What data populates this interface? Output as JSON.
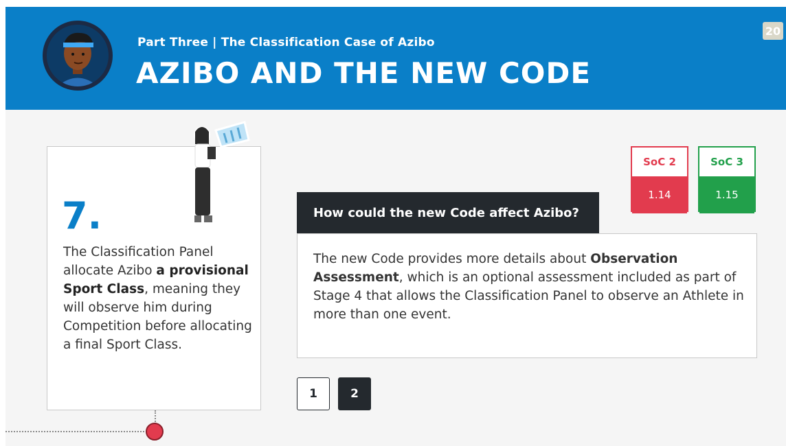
{
  "header": {
    "subtitle": "Part Three | The Classification Case of Azibo",
    "title": "AZIBO AND THE NEW CODE",
    "page_number": "20"
  },
  "left_card": {
    "step": "7.",
    "text_1": "The Classification Panel allocate Azibo ",
    "text_bold": "a provisional Sport Class",
    "text_2": ", meaning they will observe him during Competition before allocating a final Sport Class."
  },
  "soc": [
    {
      "label": "SoC 2",
      "value": "1.14",
      "color": "#e23b4e"
    },
    {
      "label": "SoC 3",
      "value": "1.15",
      "color": "#22a04b"
    }
  ],
  "question": {
    "title": "How could the new Code affect Azibo?",
    "text_1": "The new Code provides more details about ",
    "text_bold": "Observation Assessment",
    "text_2": ", which is an optional assessment included as part of Stage 4 that allows the Classification Panel to observe an Athlete in more than one event."
  },
  "pagination": [
    "1",
    "2"
  ],
  "colors": {
    "header_blue": "#0a7fc8",
    "dark": "#24292e",
    "red": "#e23b4e",
    "green": "#22a04b"
  }
}
